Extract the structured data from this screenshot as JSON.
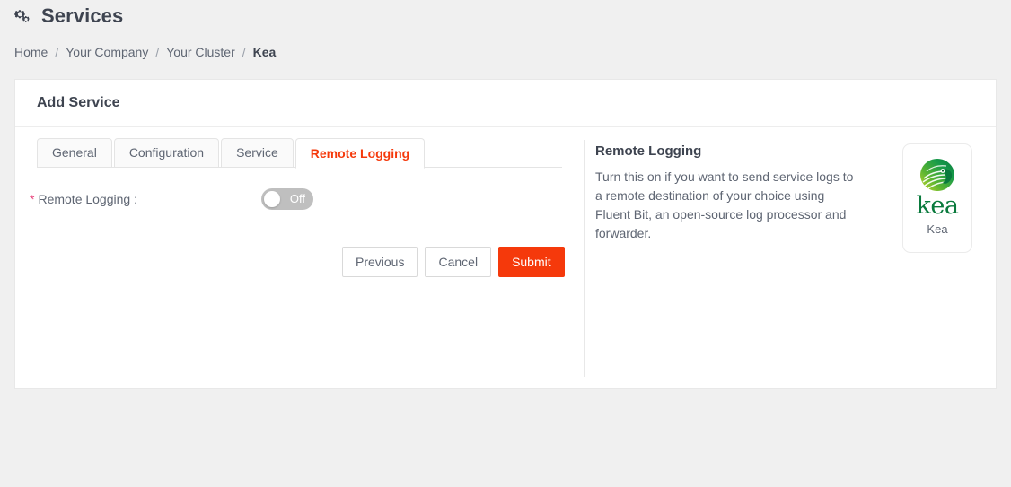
{
  "header": {
    "icon": "cogs-icon",
    "title": "Services"
  },
  "breadcrumb": {
    "separator": "/",
    "items": [
      {
        "label": "Home",
        "current": false
      },
      {
        "label": "Your Company",
        "current": false
      },
      {
        "label": "Your Cluster",
        "current": false
      },
      {
        "label": "Kea",
        "current": true
      }
    ]
  },
  "card": {
    "title": "Add Service",
    "tabs": [
      {
        "label": "General",
        "active": false
      },
      {
        "label": "Configuration",
        "active": false
      },
      {
        "label": "Service",
        "active": false
      },
      {
        "label": "Remote Logging",
        "active": true
      }
    ],
    "form": {
      "required_marker": "*",
      "field_label": "Remote Logging :",
      "toggle": {
        "state_label": "Off",
        "checked": false
      }
    },
    "buttons": {
      "previous": "Previous",
      "cancel": "Cancel",
      "submit": "Submit"
    }
  },
  "info": {
    "title": "Remote Logging",
    "description": "Turn this on if you want to send service logs to a remote destination of your choice using Fluent Bit, an open-source log processor and forwarder.",
    "logo": {
      "icon": "kea-parrot-icon",
      "wordmark": "kea",
      "caption": "Kea"
    }
  },
  "colors": {
    "accent": "#f5390b",
    "page_background": "#f0f0f0",
    "card_background": "#ffffff",
    "text": "#5f6673",
    "heading": "#3e4450",
    "required_star": "#e8447c",
    "toggle_off_track": "#bfbfbf",
    "logo_green_dark": "#0a7a3d",
    "logo_green_light": "#b5d334"
  }
}
